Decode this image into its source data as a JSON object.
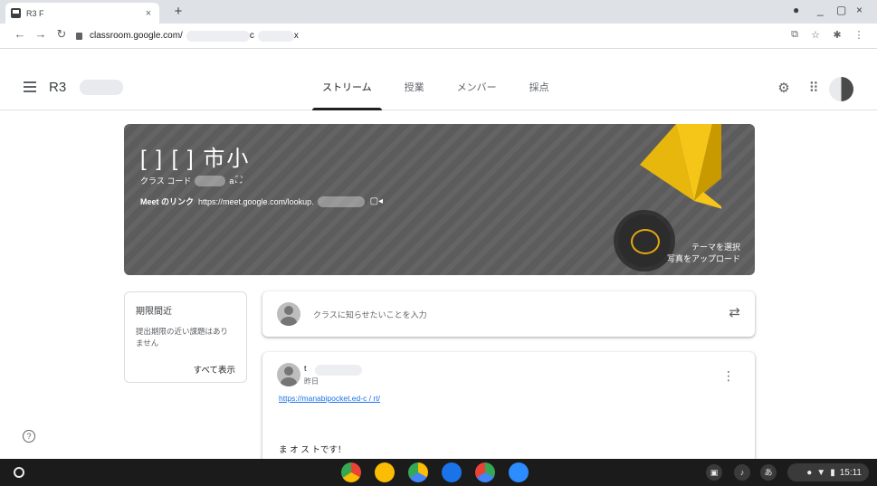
{
  "browser": {
    "tab_title": "R3 F",
    "tab_close": "×",
    "new_tab": "+",
    "url_prefix": "classroom.google.com/",
    "url_mid": "c",
    "url_tail": "x",
    "window_controls": [
      "●",
      "_",
      "▢",
      "×"
    ]
  },
  "header": {
    "class_name": "R3",
    "tabs": [
      {
        "label": "ストリーム",
        "active": true
      },
      {
        "label": "授業"
      },
      {
        "label": "メンバー"
      },
      {
        "label": "採点"
      }
    ]
  },
  "banner": {
    "title": "[  ]  [  ] 市小",
    "class_code_label": "クラス コード",
    "class_code_value": "a",
    "meet_label": "Meet のリンク",
    "meet_url": "https://meet.google.com/lookup.",
    "select_theme": "テーマを選択",
    "upload_photo": "写真をアップロード",
    "cone_color": "#f5c518"
  },
  "upcoming": {
    "heading": "期限間近",
    "description": "提出期限の近い課題はありません",
    "view_all": "すべて表示"
  },
  "share": {
    "placeholder": "クラスに知らせたいことを入力"
  },
  "post": {
    "author": "t",
    "date": "昨日",
    "link": "https://manabipocket.ed-c      /      rt/",
    "body": "ま     オ              ス     トです！"
  },
  "shelf": {
    "time": "15:11",
    "ime": "あ",
    "apps": [
      {
        "name": "chrome-app-icon",
        "color": "#ea4335"
      },
      {
        "name": "classroom-app-icon",
        "color": "#1e8e3e"
      },
      {
        "name": "drive-app-icon",
        "color": "#4285f4"
      },
      {
        "name": "files-app-icon",
        "color": "#1a73e8"
      },
      {
        "name": "play-store-app-icon",
        "color": "#34a853"
      },
      {
        "name": "zoom-app-icon",
        "color": "#2d8cff"
      }
    ]
  }
}
